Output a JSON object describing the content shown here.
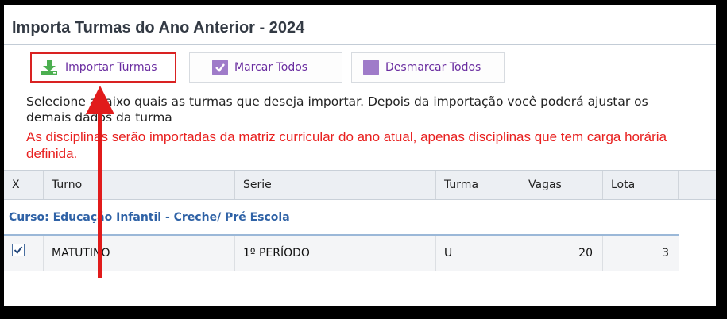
{
  "window": {
    "title": "Importa Turmas do Ano Anterior - 2024"
  },
  "toolbar": {
    "import_label": "Importar Turmas",
    "mark_all_label": "Marcar Todos",
    "unmark_all_label": "Desmarcar Todos"
  },
  "instructions": {
    "text": "Selecione abaixo quais as turmas que deseja importar. Depois da importação você poderá ajustar os demais dados da turma",
    "warning": "As disciplinas serão importadas da matriz curricular do ano atual, apenas disciplinas que tem carga horária definida."
  },
  "table": {
    "columns": [
      "X",
      "Turno",
      "Serie",
      "Turma",
      "Vagas",
      "Lota"
    ],
    "groups": [
      {
        "label": "Curso: Educação Infantil - Creche/ Pré Escola",
        "rows": [
          {
            "checked": true,
            "turno": "MATUTINO",
            "serie": "1º PERÍODO",
            "turma": "U",
            "vagas": "20",
            "lota": "3"
          }
        ]
      }
    ]
  },
  "colors": {
    "accent_purple": "#6a2da0",
    "icon_purple": "#9f7bc9",
    "warning_red": "#e8201f",
    "group_blue": "#2f62a6",
    "highlight_red": "#d92222",
    "icon_green": "#4caf50"
  },
  "icons": {
    "import": "download-icon",
    "mark_all": "checkbox-checked-icon",
    "unmark_all": "checkbox-empty-icon"
  }
}
